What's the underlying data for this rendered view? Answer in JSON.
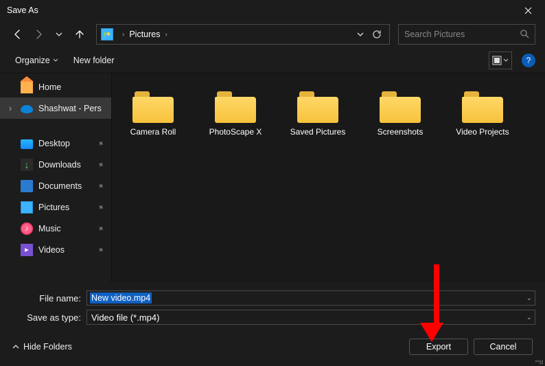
{
  "window": {
    "title": "Save As"
  },
  "nav": {
    "location": "Pictures",
    "refresh_expanded": false
  },
  "search": {
    "placeholder": "Search Pictures"
  },
  "toolbar": {
    "organize": "Organize",
    "newfolder": "New folder"
  },
  "sidebar": {
    "top": [
      {
        "label": "Home",
        "icon": "home"
      },
      {
        "label": "Shashwat - Pers",
        "icon": "onedrive",
        "expandable": true,
        "active": true
      }
    ],
    "quick": [
      {
        "label": "Desktop",
        "icon": "desktop",
        "pinned": true
      },
      {
        "label": "Downloads",
        "icon": "downloads",
        "pinned": true
      },
      {
        "label": "Documents",
        "icon": "documents",
        "pinned": true
      },
      {
        "label": "Pictures",
        "icon": "pictures",
        "pinned": true
      },
      {
        "label": "Music",
        "icon": "music",
        "pinned": true
      },
      {
        "label": "Videos",
        "icon": "videos",
        "pinned": true
      }
    ]
  },
  "folders": [
    {
      "name": "Camera Roll"
    },
    {
      "name": "PhotoScape X"
    },
    {
      "name": "Saved Pictures"
    },
    {
      "name": "Screenshots"
    },
    {
      "name": "Video Projects"
    }
  ],
  "form": {
    "filename_label": "File name:",
    "filename_value": "New video.mp4",
    "type_label": "Save as type:",
    "type_value": "Video file (*.mp4)"
  },
  "footer": {
    "hidefolders": "Hide Folders",
    "primary": "Export",
    "secondary": "Cancel"
  }
}
